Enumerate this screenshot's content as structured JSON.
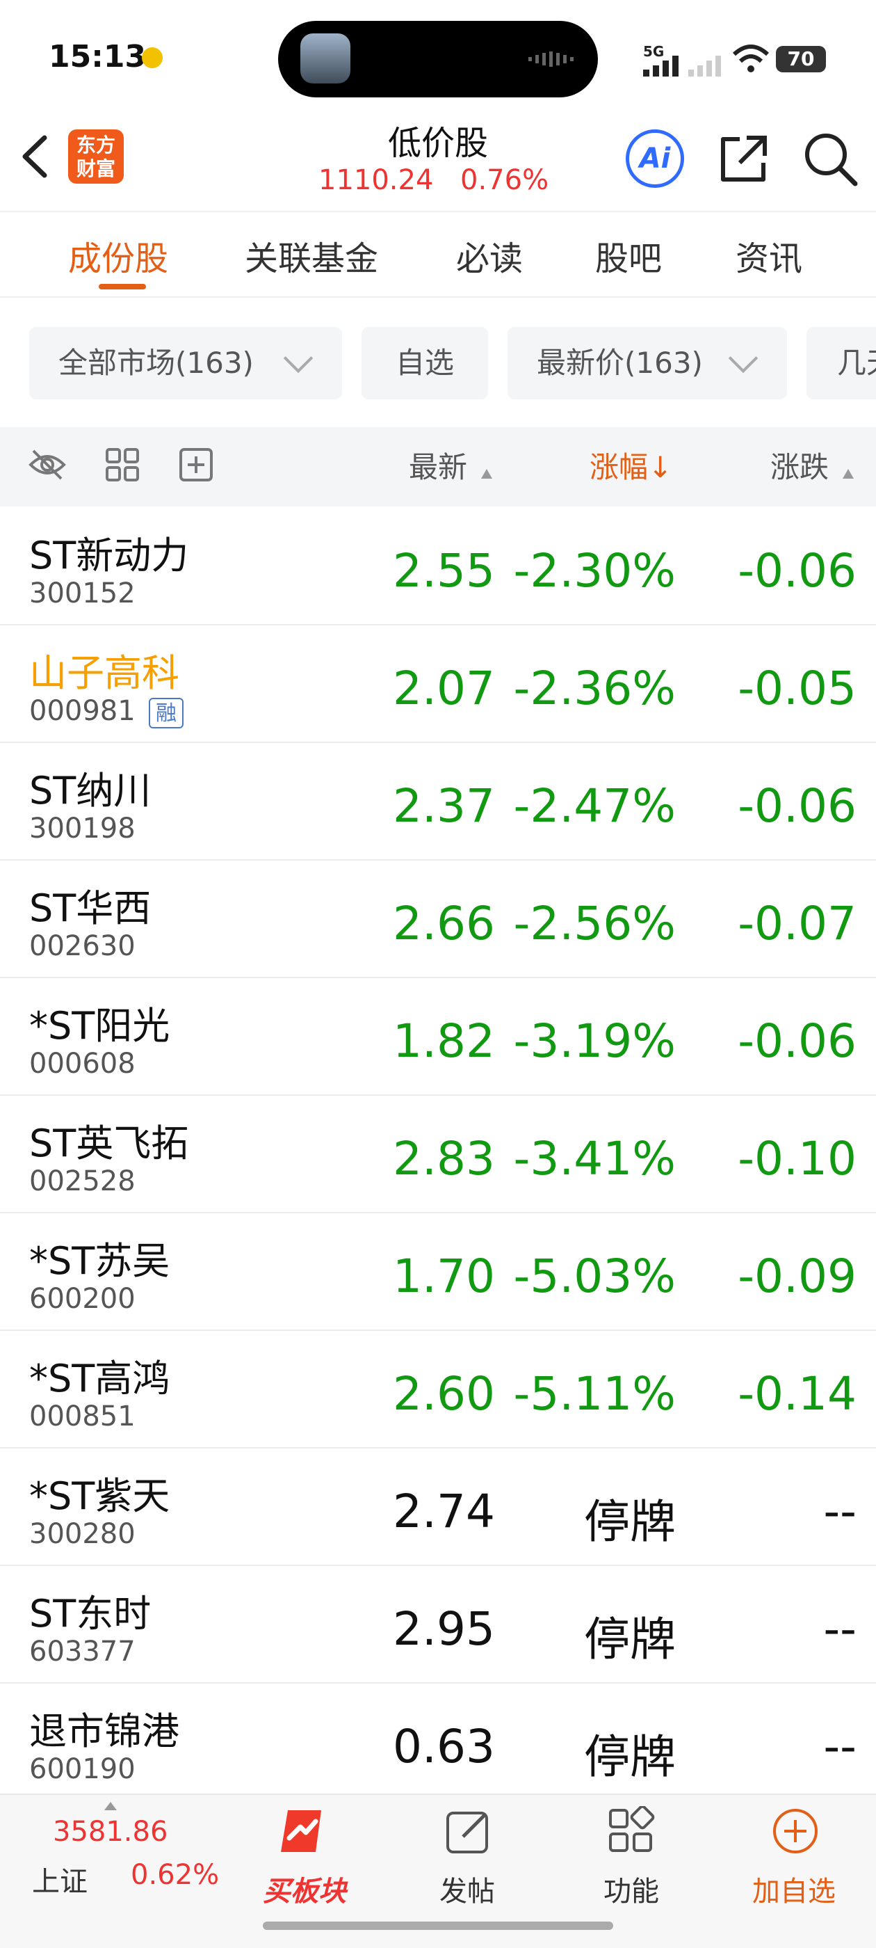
{
  "status_bar": {
    "time": "15:13",
    "network": "5G",
    "battery": "70"
  },
  "header": {
    "logo_text": "东方\n财富",
    "title": "低价股",
    "index_value": "1110.24",
    "index_change_pct": "0.76%",
    "ai_label": "Ai"
  },
  "tabs": [
    {
      "label": "成份股",
      "active": true
    },
    {
      "label": "关联基金",
      "active": false
    },
    {
      "label": "必读",
      "active": false
    },
    {
      "label": "股吧",
      "active": false
    },
    {
      "label": "资讯",
      "active": false
    }
  ],
  "filters": {
    "market": "全部市场(163)",
    "favorites": "自选",
    "price": "最新价(163)",
    "more": "几天"
  },
  "columns": {
    "latest": "最新",
    "change_pct": "涨幅",
    "change_pct_sort": "↓",
    "change": "涨跌"
  },
  "rows": [
    {
      "name": "ST新动力",
      "code": "300152",
      "price": "2.55",
      "pct": "-2.30%",
      "chg": "-0.06",
      "margin": false,
      "suspended": false
    },
    {
      "name": "山子高科",
      "code": "000981",
      "price": "2.07",
      "pct": "-2.36%",
      "chg": "-0.05",
      "margin": true,
      "margin_label": "融",
      "highlight": true,
      "suspended": false
    },
    {
      "name": "ST纳川",
      "code": "300198",
      "price": "2.37",
      "pct": "-2.47%",
      "chg": "-0.06",
      "margin": false,
      "suspended": false
    },
    {
      "name": "ST华西",
      "code": "002630",
      "price": "2.66",
      "pct": "-2.56%",
      "chg": "-0.07",
      "margin": false,
      "suspended": false
    },
    {
      "name": "*ST阳光",
      "code": "000608",
      "price": "1.82",
      "pct": "-3.19%",
      "chg": "-0.06",
      "margin": false,
      "suspended": false
    },
    {
      "name": "ST英飞拓",
      "code": "002528",
      "price": "2.83",
      "pct": "-3.41%",
      "chg": "-0.10",
      "margin": false,
      "suspended": false
    },
    {
      "name": "*ST苏吴",
      "code": "600200",
      "price": "1.70",
      "pct": "-5.03%",
      "chg": "-0.09",
      "margin": false,
      "suspended": false
    },
    {
      "name": "*ST高鸿",
      "code": "000851",
      "price": "2.60",
      "pct": "-5.11%",
      "chg": "-0.14",
      "margin": false,
      "suspended": false
    },
    {
      "name": "*ST紫天",
      "code": "300280",
      "price": "2.74",
      "pct": "停牌",
      "chg": "--",
      "margin": false,
      "suspended": true
    },
    {
      "name": "ST东时",
      "code": "603377",
      "price": "2.95",
      "pct": "停牌",
      "chg": "--",
      "margin": false,
      "suspended": true
    },
    {
      "name": "退市锦港",
      "code": "600190",
      "price": "0.63",
      "pct": "停牌",
      "chg": "--",
      "margin": false,
      "suspended": true
    }
  ],
  "bottom_bar": {
    "index_value": "3581.86",
    "index_name": "上证",
    "index_pct": "0.62%",
    "buy_sector": "买板块",
    "post": "发帖",
    "functions": "功能",
    "add_favorite": "加自选"
  },
  "colors": {
    "accent": "#e35f16",
    "up": "#e33333",
    "down": "#119911",
    "highlight_name": "#f5a000",
    "ai_blue": "#2f6bff"
  }
}
